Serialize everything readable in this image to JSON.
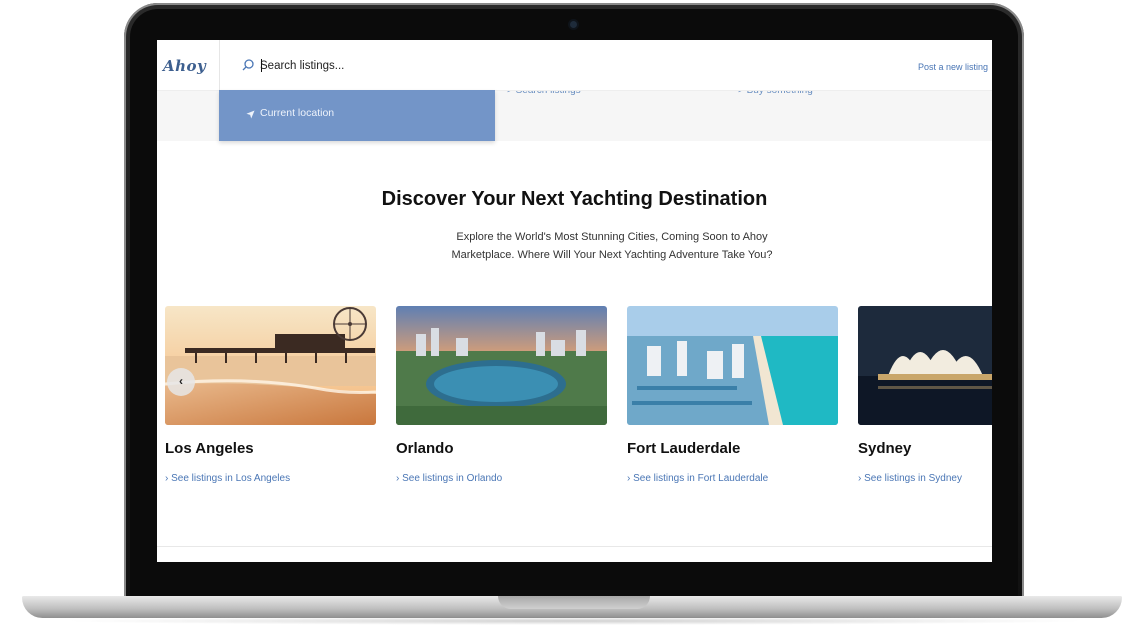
{
  "app": {
    "logo": "Ahoy"
  },
  "nav": {
    "search_placeholder": "Search listings...",
    "post_link": "Post a new listing"
  },
  "dropdown": {
    "current_location": "Current location"
  },
  "strip_links": [
    "> Search listings",
    "> Buy something"
  ],
  "hero": {
    "title": "Discover Your Next Yachting Destination",
    "subtitle": "Explore the World's Most Stunning Cities, Coming Soon to Ahoy Marketplace. Where Will Your Next Yachting Adventure Take You?"
  },
  "carousel": {
    "prev_glyph": "‹",
    "cities": [
      {
        "name": "Los Angeles",
        "link": "› See listings in Los Angeles"
      },
      {
        "name": "Orlando",
        "link": "› See listings in Orlando"
      },
      {
        "name": "Fort Lauderdale",
        "link": "› See listings in Fort Lauderdale"
      },
      {
        "name": "Sydney",
        "link": "› See listings in Sydney"
      }
    ]
  },
  "colors": {
    "accent": "#4a76b5",
    "dropdown_bg": "#7395c8",
    "logo": "#3d5f8f"
  },
  "icons": {
    "search": "search-icon",
    "location": "location-arrow-icon",
    "prev": "chevron-left-icon"
  }
}
